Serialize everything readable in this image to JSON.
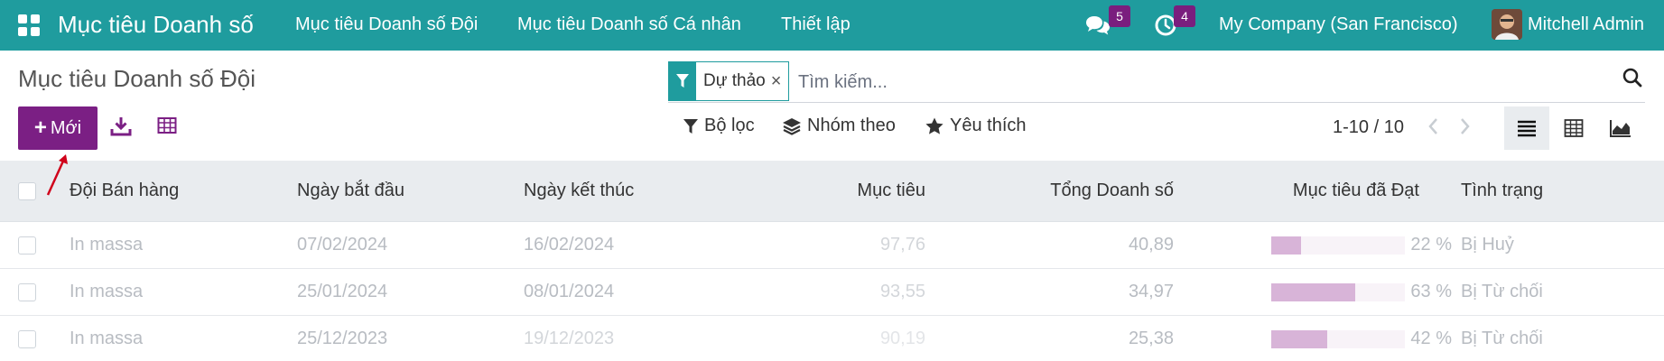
{
  "nav": {
    "app_title": "Mục tiêu Doanh số",
    "menus": [
      "Mục tiêu Doanh số Đội",
      "Mục tiêu Doanh số Cá nhân",
      "Thiết lập"
    ],
    "messages_count": "5",
    "activities_count": "4",
    "company": "My Company (San Francisco)",
    "user": "Mitchell Admin"
  },
  "page": {
    "title": "Mục tiêu Doanh số Đội"
  },
  "search": {
    "facet_label": "Dự thảo",
    "facet_close": "×",
    "placeholder": "Tìm kiếm..."
  },
  "toolbar": {
    "new_label": "Mới",
    "filters_label": "Bộ lọc",
    "groupby_label": "Nhóm theo",
    "favorites_label": "Yêu thích",
    "pager": "1-10 / 10"
  },
  "table": {
    "columns": [
      "Đội Bán hàng",
      "Ngày bắt đầu",
      "Ngày kết thúc",
      "Mục tiêu",
      "Tổng Doanh số",
      "Mục tiêu đã Đạt",
      "Tình trạng"
    ],
    "rows": [
      {
        "team": "In massa",
        "start": "07/02/2024",
        "end": "16/02/2024",
        "target": "97,76",
        "total": "40,89",
        "achieved_pct": 22,
        "achieved_label": "22 %",
        "status": "Bị Huỷ"
      },
      {
        "team": "In massa",
        "start": "25/01/2024",
        "end": "08/01/2024",
        "target": "93,55",
        "total": "34,97",
        "achieved_pct": 63,
        "achieved_label": "63 %",
        "status": "Bị Từ chối"
      },
      {
        "team": "In massa",
        "start": "25/12/2023",
        "end": "19/12/2023",
        "target": "90,19",
        "total": "25,38",
        "achieved_pct": 42,
        "achieved_label": "42 %",
        "status": "Bị Từ chối"
      }
    ]
  },
  "colors": {
    "navbar": "#1f9c9e",
    "primary_button": "#7b1f84",
    "badge": "#7a1e7e",
    "progress": "#d8b4d8",
    "annotation_arrow": "#d0021b"
  }
}
